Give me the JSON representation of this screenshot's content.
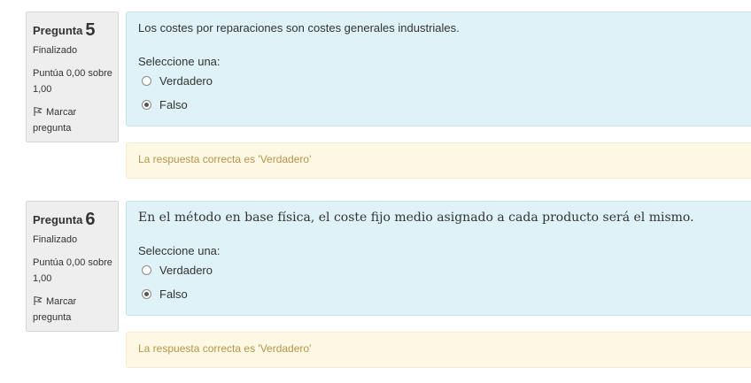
{
  "questions": [
    {
      "label": "Pregunta",
      "number": "5",
      "state": "Finalizado",
      "grade_line1": "Puntúa 0,00 sobre",
      "grade_line2": "1,00",
      "flag_line1": "Marcar",
      "flag_line2": "pregunta",
      "text": "Los costes por reparaciones son costes generales industriales.",
      "prompt": "Seleccione una:",
      "options": [
        {
          "label": "Verdadero",
          "selected": false
        },
        {
          "label": "Falso",
          "selected": true
        }
      ],
      "feedback": "La respuesta correcta es 'Verdadero'"
    },
    {
      "label": "Pregunta",
      "number": "6",
      "state": "Finalizado",
      "grade_line1": "Puntúa 0,00 sobre",
      "grade_line2": "1,00",
      "flag_line1": "Marcar",
      "flag_line2": "pregunta",
      "text": "En el método en base física, el coste fijo medio asignado a cada producto será el mismo.",
      "prompt": "Seleccione una:",
      "options": [
        {
          "label": "Verdadero",
          "selected": false
        },
        {
          "label": "Falso",
          "selected": true
        }
      ],
      "feedback": "La respuesta correcta es 'Verdadero'"
    }
  ],
  "colors": {
    "info_bg": "#eeeeee",
    "content_bg": "#def2f8",
    "feedback_bg": "#fcf8e3",
    "feedback_text": "#b7944a"
  }
}
